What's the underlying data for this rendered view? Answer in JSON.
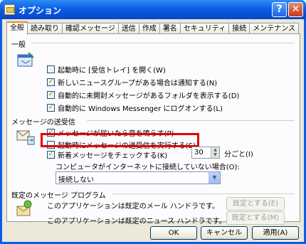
{
  "window": {
    "title": "オプション",
    "help_label": "?",
    "close_label": "✕"
  },
  "tabs": [
    {
      "label": "全般"
    },
    {
      "label": "読み取り"
    },
    {
      "label": "確認メッセージ"
    },
    {
      "label": "送信"
    },
    {
      "label": "作成"
    },
    {
      "label": "署名"
    },
    {
      "label": "セキュリティ"
    },
    {
      "label": "接続"
    },
    {
      "label": "メンテナンス"
    }
  ],
  "general": {
    "heading": "一般",
    "items": [
      {
        "label": "起動時に [受信トレイ] を開く(W)",
        "checked": false
      },
      {
        "label": "新しいニュースグループがある場合は通知する(N)",
        "checked": true
      },
      {
        "label": "自動的に未開封メッセージがあるフォルダを表示する(D)",
        "checked": true
      },
      {
        "label": "自動的に Windows Messenger にログオンする(L)",
        "checked": true
      }
    ]
  },
  "send_receive": {
    "heading": "メッセージの送受信",
    "items": [
      {
        "label": "メッセージが届いたら音を鳴らす(P)",
        "checked": true
      },
      {
        "label": "起動時にメッセージの送受信を実行する(S)",
        "checked": false
      },
      {
        "label": "新着メッセージをチェックする(K)",
        "checked": true
      }
    ],
    "interval_value": "30",
    "interval_unit": "分ごと(I)",
    "offline_label": "コンピュータがインターネットに接続していない場合(O):",
    "offline_option": "接続しない"
  },
  "default_programs": {
    "heading": "既定のメッセージ プログラム",
    "mail_text": "このアプリケーションは既定のメール ハンドラです。",
    "mail_button": "既定とする(E)",
    "news_text": "このアプリケーションは既定のニュース ハンドラです。",
    "news_button": "既定とする(M)"
  },
  "footer": {
    "ok": "OK",
    "cancel": "キャンセル",
    "apply": "適用(A)"
  }
}
